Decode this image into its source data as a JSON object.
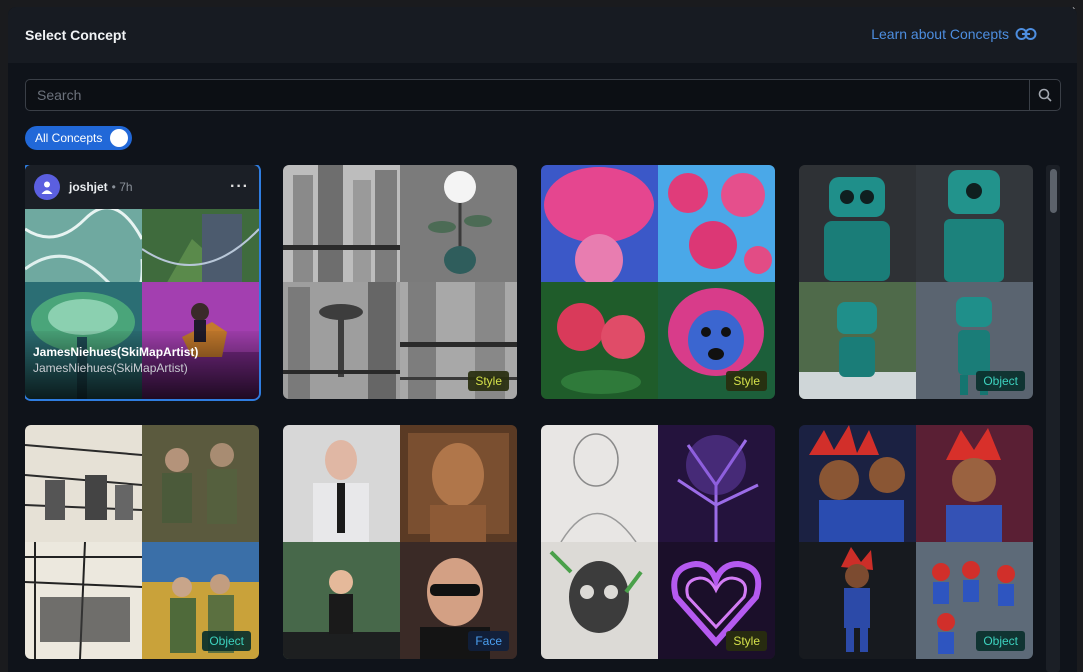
{
  "modal": {
    "title": "Select Concept",
    "learn_link": "Learn about Concepts"
  },
  "search": {
    "placeholder": "Search"
  },
  "filter_toggle": {
    "label": "All Concepts",
    "enabled": true
  },
  "colors": {
    "accent": "#2168d8",
    "link": "#4d8ee0",
    "style_badge": "#d4e04a",
    "object_badge": "#3dd3bf",
    "face_badge": "#4b9ff0"
  },
  "cards": [
    {
      "user": "joshjet",
      "time": "• 7h",
      "menu": "···",
      "name": "JamesNiehues(SkiMapArtist)",
      "desc": "JamesNiehues(SkiMapArtist)",
      "selected": true
    },
    {
      "badge": "Style",
      "subject": "grayscale city and rose"
    },
    {
      "badge": "Style",
      "subject": "pink rose heads"
    },
    {
      "badge": "Object",
      "subject": "teal robots"
    },
    {
      "badge": "Object",
      "subject": "ink sketch soldiers"
    },
    {
      "badge": "Face",
      "subject": "man in suit portraits"
    },
    {
      "badge": "Style",
      "subject": "pencil sketch and purple tree"
    },
    {
      "badge": "Object",
      "subject": "red haired anime boy"
    }
  ]
}
